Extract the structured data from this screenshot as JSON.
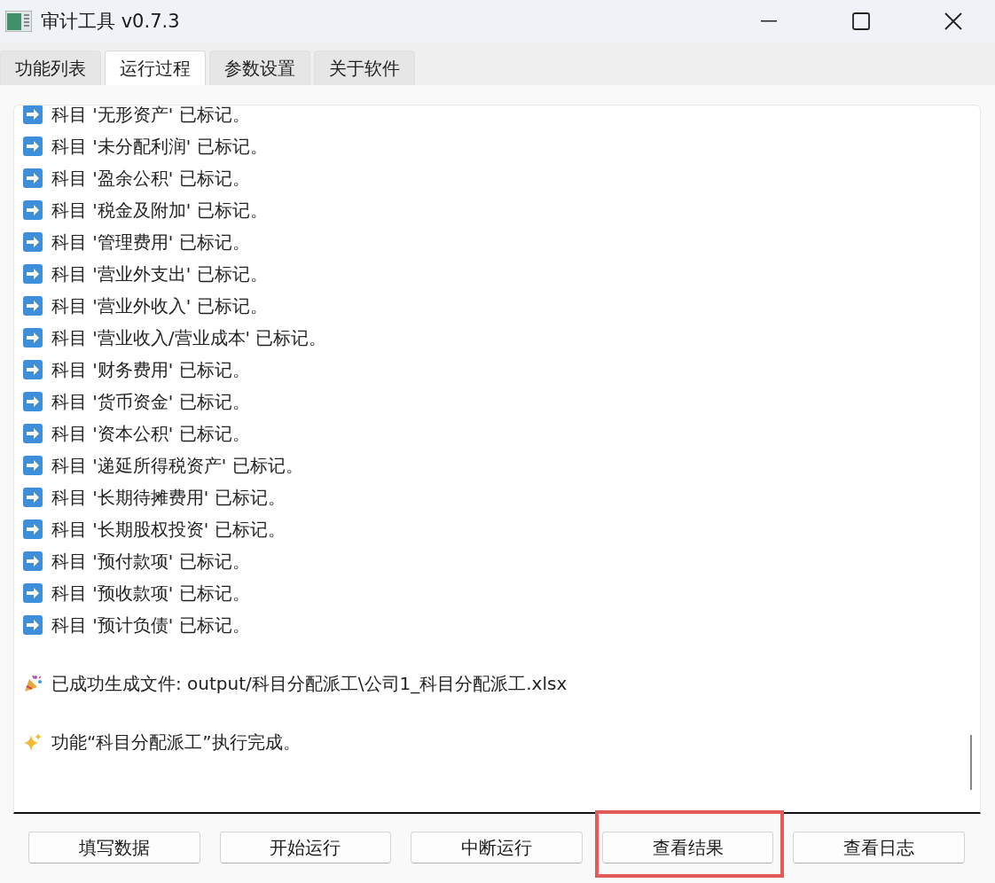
{
  "window": {
    "title": "审计工具 v0.7.3"
  },
  "tabs": [
    {
      "label": "功能列表",
      "selected": false
    },
    {
      "label": "运行过程",
      "selected": true
    },
    {
      "label": "参数设置",
      "selected": false
    },
    {
      "label": "关于软件",
      "selected": false
    }
  ],
  "log": [
    {
      "kind": "marked",
      "text": "科目 '无形资产' 已标记。"
    },
    {
      "kind": "marked",
      "text": "科目 '未分配利润' 已标记。"
    },
    {
      "kind": "marked",
      "text": "科目 '盈余公积' 已标记。"
    },
    {
      "kind": "marked",
      "text": "科目 '税金及附加' 已标记。"
    },
    {
      "kind": "marked",
      "text": "科目 '管理费用' 已标记。"
    },
    {
      "kind": "marked",
      "text": "科目 '营业外支出' 已标记。"
    },
    {
      "kind": "marked",
      "text": "科目 '营业外收入' 已标记。"
    },
    {
      "kind": "marked",
      "text": "科目 '营业收入/营业成本' 已标记。"
    },
    {
      "kind": "marked",
      "text": "科目 '财务费用' 已标记。"
    },
    {
      "kind": "marked",
      "text": "科目 '货币资金' 已标记。"
    },
    {
      "kind": "marked",
      "text": "科目 '资本公积' 已标记。"
    },
    {
      "kind": "marked",
      "text": "科目 '递延所得税资产' 已标记。"
    },
    {
      "kind": "marked",
      "text": "科目 '长期待摊费用' 已标记。"
    },
    {
      "kind": "marked",
      "text": "科目 '长期股权投资' 已标记。"
    },
    {
      "kind": "marked",
      "text": "科目 '预付款项' 已标记。"
    },
    {
      "kind": "marked",
      "text": "科目 '预收款项' 已标记。"
    },
    {
      "kind": "marked",
      "text": "科目 '预计负债' 已标记。"
    },
    {
      "kind": "file",
      "text": "已成功生成文件: output/科目分配派工\\公司1_科目分配派工.xlsx"
    },
    {
      "kind": "done",
      "text": "功能“科目分配派工”执行完成。"
    }
  ],
  "buttons": [
    {
      "label": "填写数据",
      "highlighted": false
    },
    {
      "label": "开始运行",
      "highlighted": false
    },
    {
      "label": "中断运行",
      "highlighted": false
    },
    {
      "label": "查看结果",
      "highlighted": true
    },
    {
      "label": "查看日志",
      "highlighted": false
    }
  ]
}
